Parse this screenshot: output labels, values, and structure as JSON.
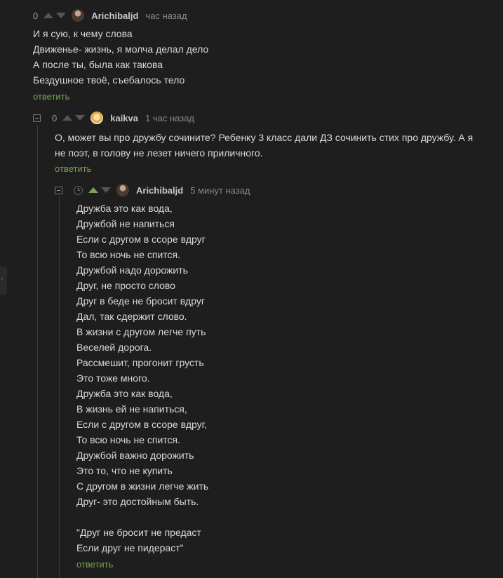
{
  "comments": [
    {
      "rating": "0",
      "username": "Arichibaljd",
      "time": "час назад",
      "lines": [
        "И я сую, к чему слова",
        "Движенье- жизнь, я молча делал дело",
        "А после ты, была как такова",
        "Бездушное твоё, съебалось тело"
      ],
      "reply_label": "ответить"
    },
    {
      "rating": "0",
      "username": "kaikva",
      "time": "1 час назад",
      "lines": [
        "О, может вы про дружбу сочините? Ребенку 3 класс дали ДЗ сочинить стих про дружбу. А я",
        "не поэт, в голову не лезет ничего приличного."
      ],
      "reply_label": "ответить"
    },
    {
      "username": "Arichibaljd",
      "time": "5 минут назад",
      "lines": [
        "Дружба это как вода,",
        "Дружбой не напиться",
        "Если с другом в ссоре вдруг",
        "То всю ночь не спится.",
        "Дружбой надо дорожить",
        "Друг, не просто слово",
        "Друг в беде не бросит вдруг",
        "Дал, так сдержит слово.",
        "В жизни с другом легче путь",
        "Веселей дорога.",
        "Рассмешит, прогонит грусть",
        "Это тоже много.",
        "Дружба это как вода,",
        "В жизнь ей не напиться,",
        "Если с другом в ссоре вдруг,",
        "То всю ночь не спится.",
        "Дружбой важно дорожить",
        "Это то, что не купить",
        "С другом в жизни легче жить",
        "Друг- это достойным быть.",
        "",
        "\"Друг не бросит не предаст",
        "Если друг не пидераст\""
      ],
      "reply_label": "ответить"
    }
  ],
  "colors": {
    "background": "#1e1e1e",
    "text": "#d9d9d9",
    "reply_link": "#7aa353",
    "vote_active": "#7aa353"
  }
}
